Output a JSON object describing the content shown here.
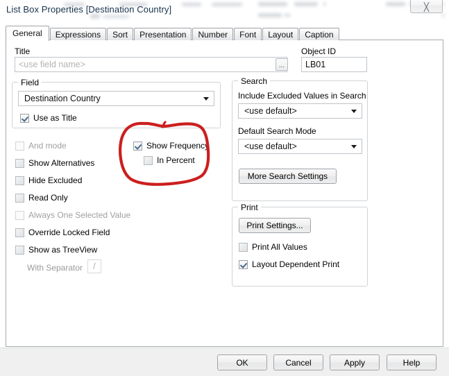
{
  "window": {
    "title": "List Box Properties [Destination Country]",
    "close_icon": "close-x-icon"
  },
  "tabs": [
    {
      "label": "General",
      "active": true
    },
    {
      "label": "Expressions",
      "active": false
    },
    {
      "label": "Sort",
      "active": false
    },
    {
      "label": "Presentation",
      "active": false
    },
    {
      "label": "Number",
      "active": false
    },
    {
      "label": "Font",
      "active": false
    },
    {
      "label": "Layout",
      "active": false
    },
    {
      "label": "Caption",
      "active": false
    }
  ],
  "general": {
    "title_label": "Title",
    "title_value": "",
    "title_placeholder": "<use field name>",
    "title_browse_label": "...",
    "object_id_label": "Object ID",
    "object_id_value": "LB01",
    "field_group": {
      "title": "Field",
      "selected_field": "Destination Country",
      "use_as_title": {
        "label": "Use as Title",
        "checked": true,
        "disabled": false
      }
    },
    "options": [
      {
        "label": "And mode",
        "checked": false,
        "disabled": true
      },
      {
        "label": "Show Alternatives",
        "checked": false,
        "disabled": false
      },
      {
        "label": "Hide Excluded",
        "checked": false,
        "disabled": false
      },
      {
        "label": "Read Only",
        "checked": false,
        "disabled": false
      },
      {
        "label": "Always One Selected Value",
        "checked": false,
        "disabled": true
      },
      {
        "label": "Override Locked Field",
        "checked": false,
        "disabled": false
      },
      {
        "label": "Show as TreeView",
        "checked": false,
        "disabled": false
      }
    ],
    "with_separator": {
      "label": "With Separator",
      "value": "/",
      "disabled": true
    },
    "frequency": {
      "show_frequency": {
        "label": "Show Frequency",
        "checked": true
      },
      "in_percent": {
        "label": "In Percent",
        "checked": false
      }
    },
    "search_group": {
      "title": "Search",
      "include_excluded_label": "Include Excluded Values in Search",
      "include_excluded_value": "<use default>",
      "default_search_mode_label": "Default Search Mode",
      "default_search_mode_value": "<use default>",
      "more_settings_label": "More Search Settings"
    },
    "print_group": {
      "title": "Print",
      "print_settings_label": "Print Settings...",
      "print_all_values": {
        "label": "Print All Values",
        "checked": false
      },
      "layout_dependent_print": {
        "label": "Layout Dependent Print",
        "checked": true
      }
    }
  },
  "footer": {
    "ok_label": "OK",
    "cancel_label": "Cancel",
    "apply_label": "Apply",
    "help_label": "Help"
  },
  "annotation": {
    "shape": "hand-drawn-ellipse",
    "color": "#cc1f1f",
    "targets": "Show Frequency / In Percent"
  }
}
